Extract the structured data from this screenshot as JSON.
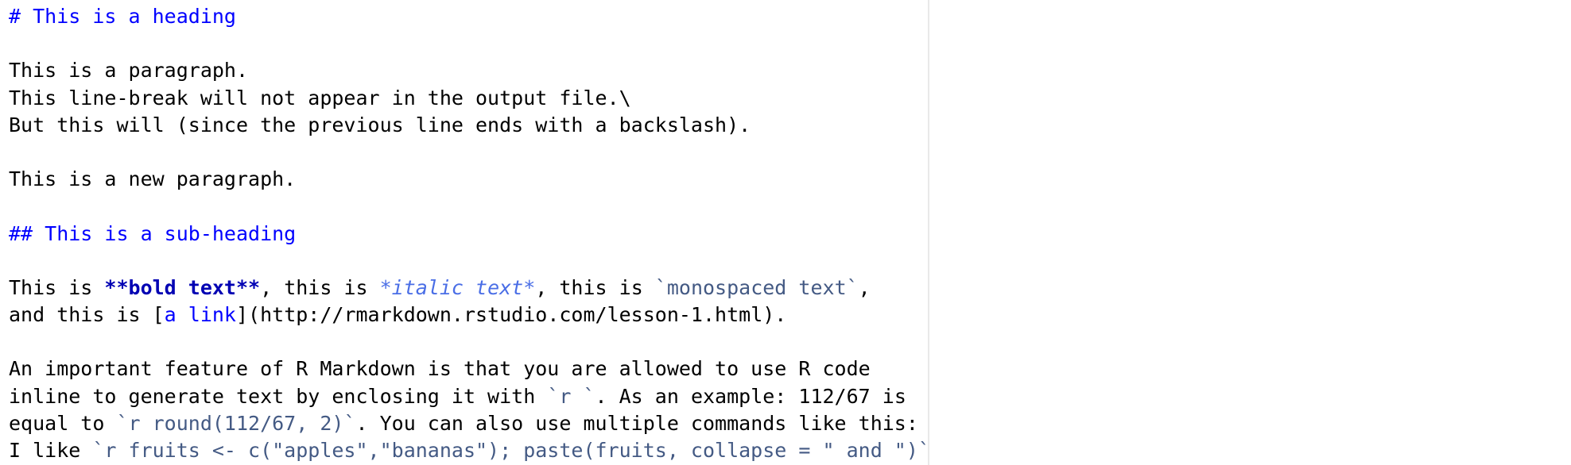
{
  "editor": {
    "colors": {
      "heading": "#0000ff",
      "bold": "#0000b3",
      "italic": "#4a6ee6",
      "code": "#445a84",
      "link": "#0000ff",
      "text": "#000000"
    },
    "lines": [
      {
        "heading": "# This is a heading"
      },
      {
        "text": ""
      },
      {
        "text": "This is a paragraph."
      },
      {
        "text": "This line-break will not appear in the output file.\\"
      },
      {
        "text": "But this will (since the previous line ends with a backslash)."
      },
      {
        "text": ""
      },
      {
        "text": "This is a new paragraph."
      },
      {
        "text": ""
      },
      {
        "heading": "## This is a sub-heading"
      },
      {
        "text": ""
      },
      {
        "t1": "This is ",
        "bold": "**bold text**",
        "t2": ", this is ",
        "italic": "*italic text*",
        "t3": ", this is ",
        "code": "`monospaced text`",
        "t4": ","
      },
      {
        "t1": "and this is [",
        "link": "a link",
        "t2": "](http://rmarkdown.rstudio.com/lesson-1.html)."
      },
      {
        "text": ""
      },
      {
        "text": "An important feature of R Markdown is that you are allowed to use R code"
      },
      {
        "t1": "inline to generate text by enclosing it with ",
        "code": "`r `",
        "t2": ". As an example: 112/67 is"
      },
      {
        "t1": "equal to ",
        "code": "`r round(112/67, 2)`",
        "t2": ". You can also use multiple commands like this:"
      },
      {
        "t1": "I like ",
        "code": "`r fruits <- c(\"apples\",\"bananas\"); paste(fruits, collapse = \" and \")`",
        "t2": "!"
      }
    ]
  }
}
